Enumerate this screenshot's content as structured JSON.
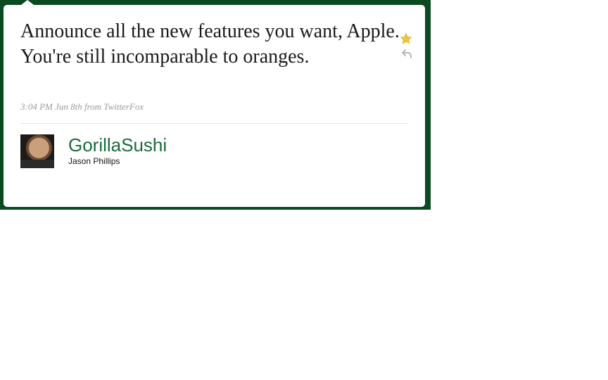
{
  "tweet": {
    "text": "Announce all the new features you want, Apple. You're still incomparable to oranges.",
    "meta": "3:04 PM Jun 8th from TwitterFox"
  },
  "user": {
    "username": "GorillaSushi",
    "real_name": "Jason Phillips"
  },
  "icons": {
    "favorite": "star-icon",
    "reply": "reply-icon"
  },
  "colors": {
    "frame": "#0b4a20",
    "username": "#1a6b3c",
    "star": "#f2c530"
  }
}
